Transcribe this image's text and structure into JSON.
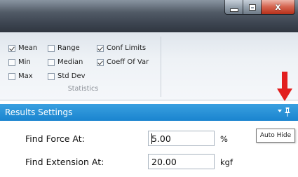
{
  "window": {
    "close_glyph": "x"
  },
  "ribbon": {
    "group_title": "Statistics",
    "options": [
      {
        "label": "Mean",
        "checked": true
      },
      {
        "label": "Min",
        "checked": false
      },
      {
        "label": "Max",
        "checked": false
      },
      {
        "label": "Range",
        "checked": false
      },
      {
        "label": "Median",
        "checked": false
      },
      {
        "label": "Std Dev",
        "checked": false
      },
      {
        "label": "Conf Limits",
        "checked": true
      },
      {
        "label": "Coeff Of Var",
        "checked": true
      }
    ]
  },
  "panel": {
    "title": "Results Settings",
    "tooltip": "Auto Hide",
    "accent_color": "#1a84cf",
    "icons": [
      "dropdown-arrow-icon",
      "pin-icon"
    ]
  },
  "form": {
    "rows": [
      {
        "label": "Find Force At:",
        "value": "5.00",
        "unit": "%"
      },
      {
        "label": "Find Extension At:",
        "value": "20.00",
        "unit": "kgf"
      }
    ]
  },
  "annotation": {
    "arrow_color": "#e21f1f"
  }
}
